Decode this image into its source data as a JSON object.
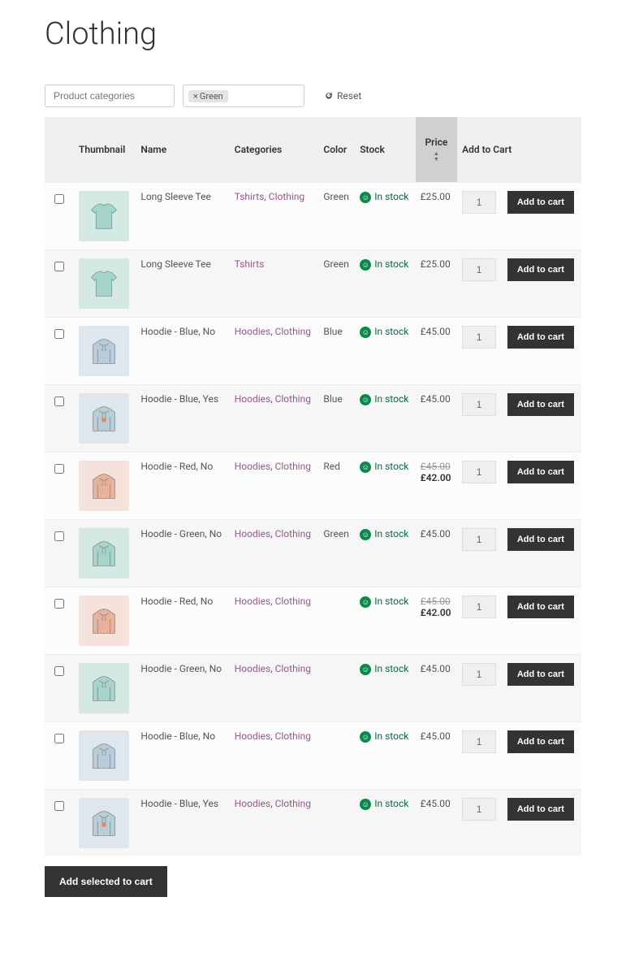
{
  "page_title": "Clothing",
  "filters": {
    "categories_placeholder": "Product categories",
    "tag_label": "Green",
    "reset_label": "Reset"
  },
  "headers": {
    "thumbnail": "Thumbnail",
    "name": "Name",
    "categories": "Categories",
    "color": "Color",
    "stock": "Stock",
    "price": "Price",
    "add_to_cart": "Add to Cart"
  },
  "stock_label": "In stock",
  "add_button_label": "Add to cart",
  "footer_button": "Add selected to cart",
  "default_qty": "1",
  "products": [
    {
      "name": "Long Sleeve Tee",
      "categories": [
        "Tshirts",
        "Clothing"
      ],
      "color": "Green",
      "price": "£25.00",
      "sale": null,
      "thumb": "tee-green"
    },
    {
      "name": "Long Sleeve Tee",
      "categories": [
        "Tshirts"
      ],
      "color": "Green",
      "price": "£25.00",
      "sale": null,
      "thumb": "tee-green"
    },
    {
      "name": "Hoodie - Blue, No",
      "categories": [
        "Hoodies",
        "Clothing"
      ],
      "color": "Blue",
      "price": "£45.00",
      "sale": null,
      "thumb": "hoodie-blue"
    },
    {
      "name": "Hoodie - Blue, Yes",
      "categories": [
        "Hoodies",
        "Clothing"
      ],
      "color": "Blue",
      "price": "£45.00",
      "sale": null,
      "thumb": "hoodie-blue-logo"
    },
    {
      "name": "Hoodie - Red, No",
      "categories": [
        "Hoodies",
        "Clothing"
      ],
      "color": "Red",
      "price": "£45.00",
      "sale": "£42.00",
      "thumb": "hoodie-red"
    },
    {
      "name": "Hoodie - Green, No",
      "categories": [
        "Hoodies",
        "Clothing"
      ],
      "color": "Green",
      "price": "£45.00",
      "sale": null,
      "thumb": "hoodie-green"
    },
    {
      "name": "Hoodie - Red, No",
      "categories": [
        "Hoodies",
        "Clothing"
      ],
      "color": "",
      "price": "£45.00",
      "sale": "£42.00",
      "thumb": "hoodie-red"
    },
    {
      "name": "Hoodie - Green, No",
      "categories": [
        "Hoodies",
        "Clothing"
      ],
      "color": "",
      "price": "£45.00",
      "sale": null,
      "thumb": "hoodie-green"
    },
    {
      "name": "Hoodie - Blue, No",
      "categories": [
        "Hoodies",
        "Clothing"
      ],
      "color": "",
      "price": "£45.00",
      "sale": null,
      "thumb": "hoodie-blue"
    },
    {
      "name": "Hoodie - Blue, Yes",
      "categories": [
        "Hoodies",
        "Clothing"
      ],
      "color": "",
      "price": "£45.00",
      "sale": null,
      "thumb": "hoodie-blue-logo"
    }
  ],
  "thumb_colors": {
    "tee-green": {
      "bg": "#d4e8e4",
      "fill": "#a5d4c9"
    },
    "hoodie-blue": {
      "bg": "#dde7ed",
      "fill": "#b7cdd9"
    },
    "hoodie-blue-logo": {
      "bg": "#dde7ed",
      "fill": "#b7cdd9"
    },
    "hoodie-red": {
      "bg": "#f5e3db",
      "fill": "#e8b199"
    },
    "hoodie-green": {
      "bg": "#d4e8e4",
      "fill": "#a5d4c9"
    }
  }
}
